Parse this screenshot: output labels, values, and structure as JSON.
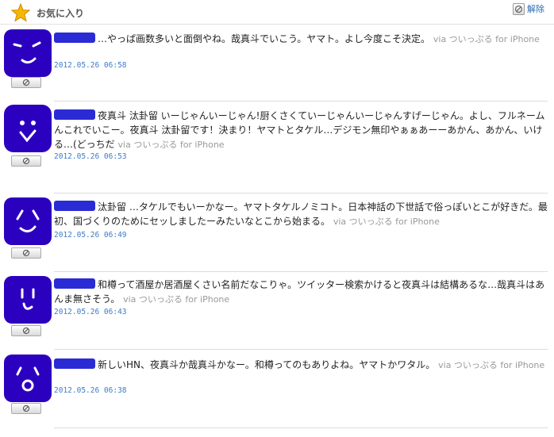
{
  "header": {
    "title": "お気に入り",
    "unfavorite_label": "解除",
    "star_icon": "star-icon",
    "accent": "#f0a500"
  },
  "tweets": [
    {
      "text": "…やっぱ画数多いと面倒やね。哉真斗でいこう。ヤマト。よし今度こそ決定。",
      "via": "via ついっぷる for iPhone",
      "timestamp": "2012.05.26 06:58"
    },
    {
      "text": "夜真斗 汰卦留 いーじゃんいーじゃん!厨くさくていーじゃんいーじゃんすげーじゃん。よし、フルネームんこれでいこー。夜真斗 汰卦留です！決まり！ヤマトとタケル…デジモン無印やぁぁあーーあかん、あかん、いける…(どっちだ",
      "via": "via ついっぷる for iPhone",
      "timestamp": "2012.05.26 06:53"
    },
    {
      "text": "汰卦留 …タケルでもいーかなー。ヤマトタケルノミコト。日本神話の下世話で俗っぽいとこが好きだ。最初、国づくりのためにセッしましたーみたいなとこから始まる。",
      "via": "via ついっぷる for iPhone",
      "timestamp": "2012.05.26 06:49"
    },
    {
      "text": "和樽って酒屋か居酒屋くさい名前だなこりゃ。ツイッター検索かけると夜真斗は結構あるな…哉真斗はあんま無さそう。",
      "via": "via ついっぷる for iPhone",
      "timestamp": "2012.05.26 06:43"
    },
    {
      "text": "新しいHN、夜真斗か哉真斗かなー。和樽ってのもありよね。ヤマトかワタル。",
      "via": "via ついっぷる for iPhone",
      "timestamp": "2012.05.26 06:38"
    }
  ],
  "colors": {
    "avatar_fill": "#2c00bf",
    "link": "#3d7cc9",
    "via": "#999999"
  }
}
